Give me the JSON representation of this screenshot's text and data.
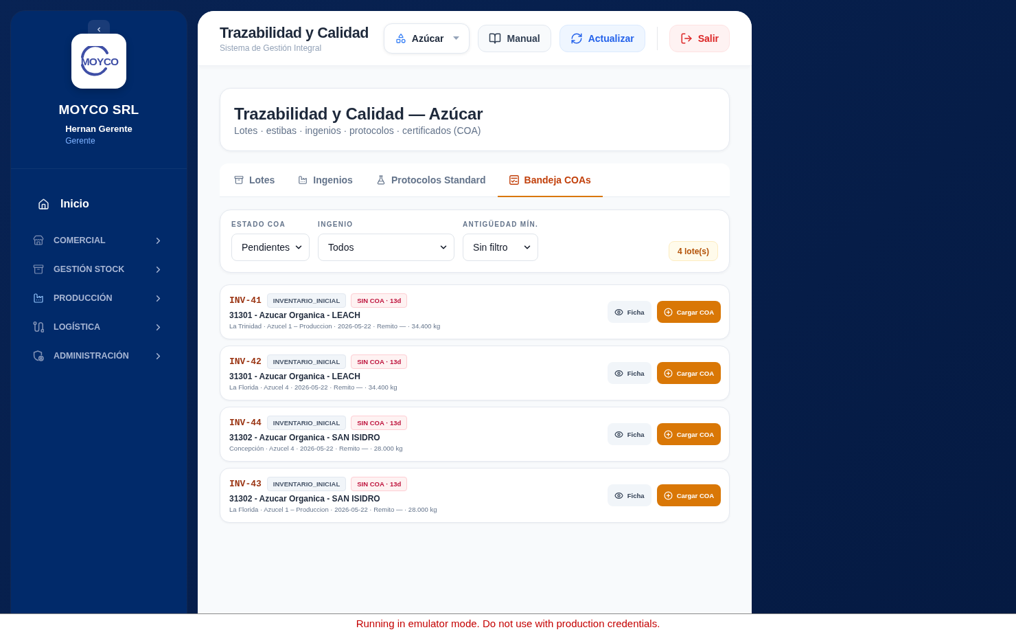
{
  "sidebar": {
    "logo_text": "MOYCO",
    "company": "MOYCO SRL",
    "user_name": "Hernan Gerente",
    "user_role": "Gerente",
    "home": {
      "label": "Inicio"
    },
    "groups": [
      {
        "label": "COMERCIAL",
        "selected": false
      },
      {
        "label": "GESTIÓN STOCK",
        "selected": false
      },
      {
        "label": "PRODUCCIÓN",
        "selected": true
      },
      {
        "label": "LOGÍSTICA",
        "selected": false
      },
      {
        "label": "ADMINISTRACIÓN",
        "selected": false
      }
    ]
  },
  "header": {
    "title": "Trazabilidad y Calidad",
    "subtitle": "Sistema de Gestión Integral",
    "product_select": {
      "value": "Azúcar"
    },
    "actions": [
      {
        "label": "Manual",
        "kind": "neutral"
      },
      {
        "label": "Actualizar",
        "kind": "primary"
      }
    ],
    "logout": {
      "label": "Salir"
    }
  },
  "page_card": {
    "title": "Trazabilidad y Calidad — Azúcar",
    "subtitle": "Lotes · estibas · ingenios · protocolos · certificados (COA)"
  },
  "tabs": [
    {
      "label": "Lotes",
      "selected": false
    },
    {
      "label": "Ingenios",
      "selected": false
    },
    {
      "label": "Protocolos Standard",
      "selected": false
    },
    {
      "label": "Bandeja COAs",
      "selected": true
    }
  ],
  "filters": [
    {
      "label": "ESTADO COA",
      "value": "Pendientes"
    },
    {
      "label": "INGENIO",
      "value": "Todos"
    },
    {
      "label": "ANTIGÜEDAD MÍN.",
      "value": "Sin filtro"
    }
  ],
  "count_badge": "4 lote(s)",
  "lots": [
    {
      "code": "INV-41",
      "origin": "INVENTARIO_INICIAL",
      "status": "SIN COA · 13d",
      "title": "31301 - Azucar Organica - LEACH",
      "details": "La Trinidad · Azucel 1 – Produccion · 2026-05-22 · Remito — · 34.400 kg",
      "view_label": "Ficha",
      "upload_label": "Cargar COA"
    },
    {
      "code": "INV-42",
      "origin": "INVENTARIO_INICIAL",
      "status": "SIN COA · 13d",
      "title": "31301 - Azucar Organica - LEACH",
      "details": "La Florida · Azucel 4 · 2026-05-22 · Remito — · 34.400 kg",
      "view_label": "Ficha",
      "upload_label": "Cargar COA"
    },
    {
      "code": "INV-44",
      "origin": "INVENTARIO_INICIAL",
      "status": "SIN COA · 13d",
      "title": "31302 - Azucar Organica - SAN ISIDRO",
      "details": "Concepción · Azucel 4 · 2026-05-22 · Remito — · 28.000 kg",
      "view_label": "Ficha",
      "upload_label": "Cargar COA"
    },
    {
      "code": "INV-43",
      "origin": "INVENTARIO_INICIAL",
      "status": "SIN COA · 13d",
      "title": "31302 - Azucar Organica - SAN ISIDRO",
      "details": "La Florida · Azucel 1 – Produccion · 2026-05-22 · Remito — · 28.000 kg",
      "view_label": "Ficha",
      "upload_label": "Cargar COA"
    }
  ],
  "emulator_banner": "Running in emulator mode. Do not use with production credentials."
}
